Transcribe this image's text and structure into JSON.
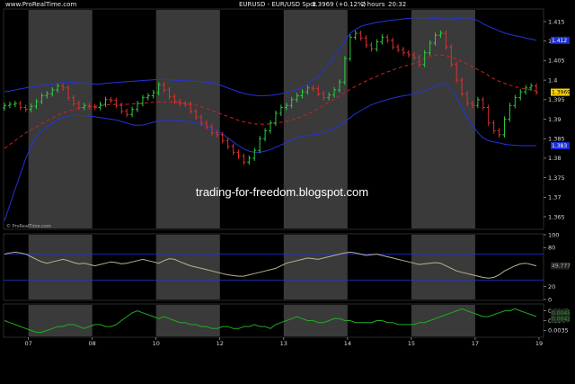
{
  "header": {
    "site": "www.ProRealTime.com",
    "instrument": "EURUSD - EUR/USD Spot",
    "quote": "1.3969 (+0.12%)",
    "timeframe": "2 hours",
    "time": "20:32"
  },
  "watermark": "trading-for-freedom.blogspot.com",
  "panel_credit": "© ProRealTime.com",
  "colors": {
    "background": "#000000",
    "band_stripe": "#3a3a3a",
    "candle_up": "#2ecc40",
    "candle_down": "#e0302f",
    "bollinger": "#2233dd",
    "mid_ma": "#d02020",
    "oscillator_line": "#b9b48c",
    "momentum_line": "#22aa22",
    "price_tag_bg": "#ffd400",
    "upper_tag_bg": "#1b2fd0",
    "lower_tag_bg": "#1b2fd0"
  },
  "chart_data": [
    {
      "type": "candlestick",
      "title": "EURUSD - EUR/USD Spot",
      "ylim": [
        1.362,
        1.418
      ],
      "yticks": [
        "1.415",
        "1.41",
        "1.405",
        "1.4",
        "1.395",
        "1.39",
        "1.385",
        "1.38",
        "1.375",
        "1.37",
        "1.365"
      ],
      "ytick_values": [
        1.415,
        1.41,
        1.405,
        1.4,
        1.395,
        1.39,
        1.385,
        1.38,
        1.375,
        1.37,
        1.365
      ],
      "x_labels": [
        "07",
        "08",
        "10",
        "12",
        "13",
        "14",
        "15",
        "17",
        "19"
      ],
      "x_label_index": [
        5,
        17,
        29,
        41,
        53,
        65,
        77,
        89,
        101
      ],
      "session_stripes": [
        [
          5,
          17
        ],
        [
          29,
          41
        ],
        [
          53,
          65
        ],
        [
          77,
          89
        ]
      ],
      "close": [
        1.3935,
        1.3938,
        1.394,
        1.393,
        1.3925,
        1.3933,
        1.3945,
        1.396,
        1.3965,
        1.3975,
        1.3985,
        1.398,
        1.3955,
        1.394,
        1.393,
        1.3935,
        1.3932,
        1.393,
        1.3938,
        1.395,
        1.3948,
        1.3935,
        1.392,
        1.3912,
        1.3925,
        1.394,
        1.3955,
        1.396,
        1.3968,
        1.3988,
        1.3975,
        1.3958,
        1.3945,
        1.394,
        1.3938,
        1.392,
        1.3905,
        1.389,
        1.388,
        1.3865,
        1.386,
        1.3845,
        1.383,
        1.3815,
        1.3805,
        1.379,
        1.38,
        1.382,
        1.385,
        1.387,
        1.389,
        1.3915,
        1.393,
        1.3935,
        1.395,
        1.396,
        1.397,
        1.398,
        1.3978,
        1.3965,
        1.3955,
        1.3962,
        1.3975,
        1.3995,
        1.4055,
        1.411,
        1.412,
        1.4108,
        1.409,
        1.408,
        1.4098,
        1.411,
        1.4102,
        1.4085,
        1.4078,
        1.407,
        1.4065,
        1.4058,
        1.404,
        1.407,
        1.4095,
        1.4115,
        1.412,
        1.4085,
        1.404,
        1.4,
        1.3965,
        1.394,
        1.3935,
        1.395,
        1.393,
        1.389,
        1.387,
        1.386,
        1.39,
        1.3935,
        1.3955,
        1.397,
        1.398,
        1.3985,
        1.3969
      ],
      "bollinger_upper": [
        1.397,
        1.3972,
        1.3975,
        1.3978,
        1.398,
        1.3982,
        1.3984,
        1.3986,
        1.3988,
        1.399,
        1.3992,
        1.3994,
        1.3995,
        1.3994,
        1.3993,
        1.3992,
        1.3991,
        1.399,
        1.399,
        1.3992,
        1.3993,
        1.3994,
        1.3995,
        1.3996,
        1.3997,
        1.3998,
        1.3999,
        1.4,
        1.4001,
        1.4002,
        1.4002,
        1.4001,
        1.4,
        1.3999,
        1.3998,
        1.3998,
        1.3997,
        1.3996,
        1.3995,
        1.3994,
        1.399,
        1.3985,
        1.398,
        1.3975,
        1.397,
        1.3966,
        1.3963,
        1.3961,
        1.396,
        1.396,
        1.3961,
        1.3963,
        1.3965,
        1.3968,
        1.3972,
        1.3976,
        1.3982,
        1.399,
        1.4,
        1.401,
        1.4025,
        1.404,
        1.406,
        1.408,
        1.41,
        1.412,
        1.413,
        1.4138,
        1.4142,
        1.4145,
        1.4148,
        1.415,
        1.4152,
        1.4154,
        1.4155,
        1.4157,
        1.4158,
        1.416,
        1.416,
        1.416,
        1.4159,
        1.4158,
        1.4157,
        1.4157,
        1.4157,
        1.4158,
        1.4159,
        1.416,
        1.4158,
        1.4152,
        1.4144,
        1.4138,
        1.4132,
        1.4126,
        1.4121,
        1.4117,
        1.4114,
        1.4111,
        1.4108,
        1.4105,
        1.4102
      ],
      "bollinger_lower": [
        1.364,
        1.368,
        1.372,
        1.376,
        1.38,
        1.383,
        1.3855,
        1.387,
        1.388,
        1.389,
        1.3898,
        1.3904,
        1.3908,
        1.391,
        1.391,
        1.3909,
        1.3908,
        1.3906,
        1.3904,
        1.3902,
        1.39,
        1.3898,
        1.3894,
        1.389,
        1.3886,
        1.3884,
        1.3885,
        1.3888,
        1.3892,
        1.3896,
        1.3898,
        1.3898,
        1.3897,
        1.3896,
        1.3895,
        1.3893,
        1.389,
        1.3886,
        1.3882,
        1.3876,
        1.387,
        1.3862,
        1.3852,
        1.3842,
        1.3832,
        1.3824,
        1.3818,
        1.3815,
        1.3815,
        1.3818,
        1.3822,
        1.3828,
        1.3834,
        1.384,
        1.3846,
        1.3852,
        1.3856,
        1.3858,
        1.386,
        1.3862,
        1.3865,
        1.387,
        1.3876,
        1.3884,
        1.3894,
        1.3904,
        1.3914,
        1.3922,
        1.393,
        1.3937,
        1.3942,
        1.3946,
        1.395,
        1.3954,
        1.3957,
        1.396,
        1.3962,
        1.3965,
        1.3968,
        1.3972,
        1.3978,
        1.3985,
        1.3992,
        1.3988,
        1.3975,
        1.3955,
        1.393,
        1.3905,
        1.3885,
        1.3865,
        1.3852,
        1.3845,
        1.3842,
        1.3839,
        1.3836,
        1.3834,
        1.3833,
        1.3832,
        1.3832,
        1.3832,
        1.3832
      ],
      "moving_average": [
        1.3825,
        1.3835,
        1.3845,
        1.3855,
        1.3865,
        1.3873,
        1.388,
        1.3888,
        1.3896,
        1.3903,
        1.391,
        1.3916,
        1.3921,
        1.3925,
        1.3928,
        1.393,
        1.3932,
        1.3933,
        1.3934,
        1.3936,
        1.3937,
        1.3938,
        1.3938,
        1.3938,
        1.3939,
        1.394,
        1.3941,
        1.3942,
        1.3943,
        1.3944,
        1.3944,
        1.3944,
        1.3943,
        1.3942,
        1.3941,
        1.3939,
        1.3936,
        1.3932,
        1.3927,
        1.3922,
        1.3917,
        1.3912,
        1.3907,
        1.3902,
        1.3897,
        1.3893,
        1.389,
        1.3888,
        1.3887,
        1.3887,
        1.3888,
        1.389,
        1.3892,
        1.3895,
        1.3898,
        1.3902,
        1.3907,
        1.3913,
        1.392,
        1.3927,
        1.3935,
        1.3943,
        1.3951,
        1.396,
        1.3968,
        1.3976,
        1.3984,
        1.3991,
        1.3998,
        1.4004,
        1.401,
        1.4016,
        1.4021,
        1.4026,
        1.4031,
        1.4035,
        1.4039,
        1.4043,
        1.4048,
        1.4055,
        1.406,
        1.4064,
        1.4065,
        1.4063,
        1.4059,
        1.4054,
        1.4048,
        1.4041,
        1.4034,
        1.4027,
        1.402,
        1.4012,
        1.4004,
        1.3997,
        1.3992,
        1.3987,
        1.3983,
        1.398,
        1.3977,
        1.3975,
        1.3972
      ],
      "last_price_label": "1.3969",
      "upper_band_label": "1.412",
      "lower_band_label": "1.383"
    },
    {
      "type": "line",
      "ylim": [
        0,
        100
      ],
      "yticks": [
        "100",
        "80",
        "20",
        "0"
      ],
      "ytick_values": [
        100,
        80,
        20,
        0
      ],
      "levels": [
        70,
        30
      ],
      "values": [
        70,
        72,
        73,
        72,
        70,
        66,
        62,
        58,
        56,
        58,
        60,
        62,
        60,
        57,
        55,
        56,
        54,
        52,
        54,
        56,
        58,
        57,
        55,
        56,
        58,
        60,
        62,
        60,
        58,
        56,
        60,
        63,
        62,
        58,
        55,
        52,
        50,
        48,
        46,
        44,
        42,
        40,
        38,
        37,
        36,
        36,
        38,
        40,
        42,
        44,
        46,
        48,
        52,
        56,
        58,
        60,
        62,
        64,
        63,
        62,
        64,
        66,
        68,
        70,
        72,
        73,
        72,
        70,
        68,
        69,
        70,
        68,
        66,
        64,
        62,
        60,
        58,
        56,
        54,
        55,
        56,
        57,
        56,
        52,
        48,
        44,
        42,
        40,
        38,
        36,
        34,
        33,
        34,
        38,
        44,
        48,
        52,
        55,
        56,
        54,
        52
      ],
      "last_label": "49.777"
    },
    {
      "type": "line",
      "ylim": [
        0.0032,
        0.0048
      ],
      "yticks": [
        "0.0045",
        "0.004",
        "0.0035"
      ],
      "ytick_values": [
        0.0045,
        0.004,
        0.0035
      ],
      "values": [
        0.004,
        0.0039,
        0.0038,
        0.0037,
        0.0036,
        0.0035,
        0.0034,
        0.0034,
        0.0035,
        0.0036,
        0.0037,
        0.0037,
        0.0038,
        0.0038,
        0.0037,
        0.0036,
        0.0037,
        0.0038,
        0.0038,
        0.0037,
        0.0037,
        0.0038,
        0.004,
        0.0042,
        0.0044,
        0.0045,
        0.0044,
        0.0043,
        0.0042,
        0.0041,
        0.0042,
        0.0041,
        0.004,
        0.0039,
        0.0039,
        0.0038,
        0.0038,
        0.0037,
        0.0037,
        0.0036,
        0.0036,
        0.0037,
        0.0037,
        0.0036,
        0.0036,
        0.0037,
        0.0037,
        0.0038,
        0.0037,
        0.0037,
        0.0036,
        0.0038,
        0.0039,
        0.004,
        0.0041,
        0.0042,
        0.0041,
        0.004,
        0.004,
        0.0039,
        0.0039,
        0.004,
        0.0041,
        0.0041,
        0.004,
        0.004,
        0.0039,
        0.0039,
        0.0039,
        0.0039,
        0.004,
        0.004,
        0.0039,
        0.0039,
        0.0038,
        0.0038,
        0.0038,
        0.0038,
        0.0039,
        0.0039,
        0.004,
        0.0041,
        0.0042,
        0.0043,
        0.0044,
        0.0045,
        0.0046,
        0.0045,
        0.0044,
        0.0043,
        0.0042,
        0.0042,
        0.0043,
        0.0044,
        0.0045,
        0.0045,
        0.0046,
        0.0045,
        0.0044,
        0.0043,
        0.0042
      ],
      "labels": [
        "0.0045",
        "0.0042"
      ]
    }
  ]
}
